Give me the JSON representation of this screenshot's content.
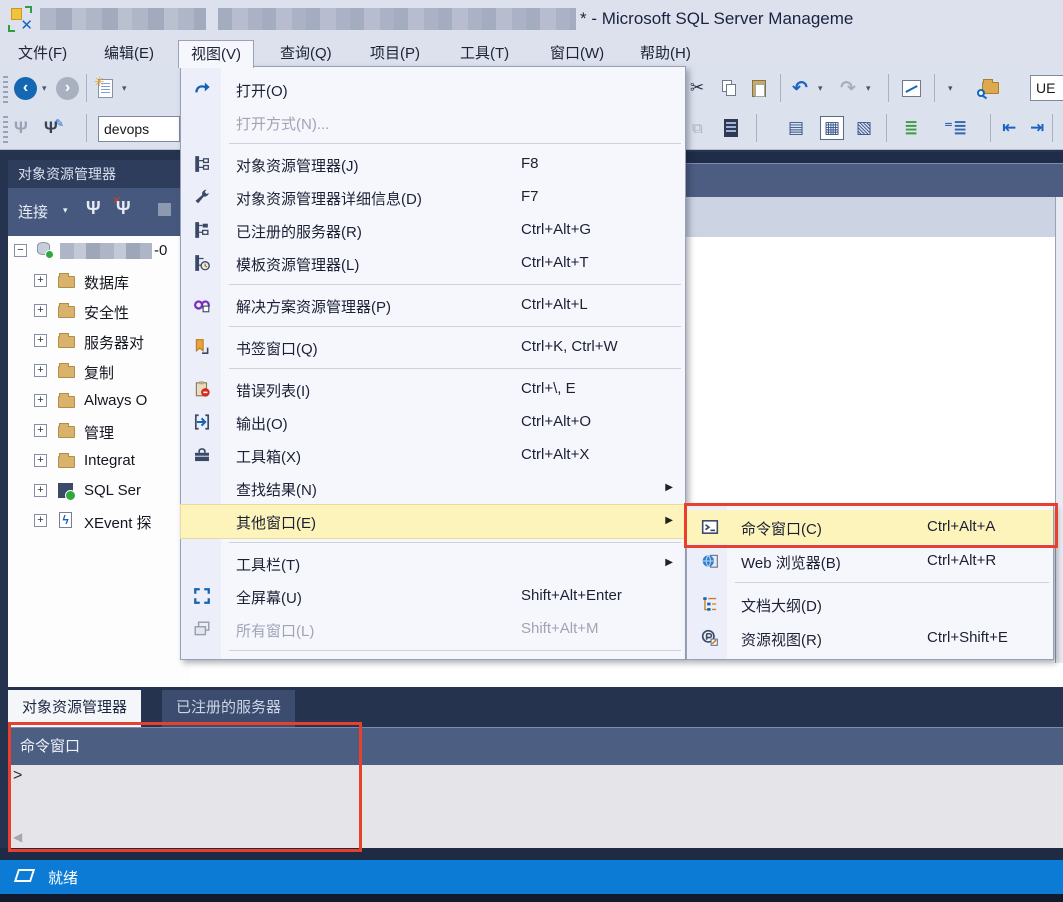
{
  "window": {
    "title": "* - Microsoft SQL Server Manageme"
  },
  "menubar": {
    "items": [
      {
        "label": "文件(F)"
      },
      {
        "label": "编辑(E)"
      },
      {
        "label": "视图(V)",
        "open": true
      },
      {
        "label": "查询(Q)"
      },
      {
        "label": "项目(P)"
      },
      {
        "label": "工具(T)"
      },
      {
        "label": "窗口(W)"
      },
      {
        "label": "帮助(H)"
      }
    ]
  },
  "toolbar": {
    "database_combo": "devops",
    "right_combo": "UE"
  },
  "view_menu": {
    "items": [
      {
        "label": "打开(O)",
        "shortcut": ""
      },
      {
        "label": "打开方式(N)...",
        "shortcut": "",
        "disabled": true
      },
      {
        "label": "对象资源管理器(J)",
        "shortcut": "F8"
      },
      {
        "label": "对象资源管理器详细信息(D)",
        "shortcut": "F7"
      },
      {
        "label": "已注册的服务器(R)",
        "shortcut": "Ctrl+Alt+G"
      },
      {
        "label": "模板资源管理器(L)",
        "shortcut": "Ctrl+Alt+T"
      },
      {
        "label": "解决方案资源管理器(P)",
        "shortcut": "Ctrl+Alt+L"
      },
      {
        "label": "书签窗口(Q)",
        "shortcut": "Ctrl+K, Ctrl+W"
      },
      {
        "label": "错误列表(I)",
        "shortcut": "Ctrl+\\, E"
      },
      {
        "label": "输出(O)",
        "shortcut": "Ctrl+Alt+O"
      },
      {
        "label": "工具箱(X)",
        "shortcut": "Ctrl+Alt+X"
      },
      {
        "label": "查找结果(N)",
        "shortcut": "",
        "submenu": true
      },
      {
        "label": "其他窗口(E)",
        "shortcut": "",
        "submenu": true,
        "highlighted": true
      },
      {
        "label": "工具栏(T)",
        "shortcut": "",
        "submenu": true
      },
      {
        "label": "全屏幕(U)",
        "shortcut": "Shift+Alt+Enter"
      },
      {
        "label": "所有窗口(L)",
        "shortcut": "Shift+Alt+M",
        "disabled": true
      }
    ]
  },
  "other_windows_submenu": {
    "items": [
      {
        "label": "命令窗口(C)",
        "shortcut": "Ctrl+Alt+A",
        "highlighted": true,
        "annotated": true
      },
      {
        "label": "Web 浏览器(B)",
        "shortcut": "Ctrl+Alt+R"
      },
      {
        "label": "文档大纲(D)",
        "shortcut": ""
      },
      {
        "label": "资源视图(R)",
        "shortcut": "Ctrl+Shift+E"
      }
    ]
  },
  "object_explorer": {
    "title": "对象资源管理器",
    "connect_label": "连接",
    "server_suffix": "-0",
    "tree": [
      {
        "label": "数据库"
      },
      {
        "label": "安全性"
      },
      {
        "label": "服务器对"
      },
      {
        "label": "复制"
      },
      {
        "label": "Always O"
      },
      {
        "label": "管理"
      },
      {
        "label": "Integrat"
      },
      {
        "label": "SQL Ser"
      },
      {
        "label": "XEvent 探"
      }
    ]
  },
  "panel_tabs": {
    "object_explorer": "对象资源管理器",
    "registered_servers": "已注册的服务器"
  },
  "command_window": {
    "title": "命令窗口",
    "prompt": ">"
  },
  "status_bar": {
    "text": "就绪"
  },
  "colors": {
    "annotation_red": "#e8402c",
    "highlight_yellow": "#fdf4bb",
    "status_blue": "#0c7bd6"
  }
}
